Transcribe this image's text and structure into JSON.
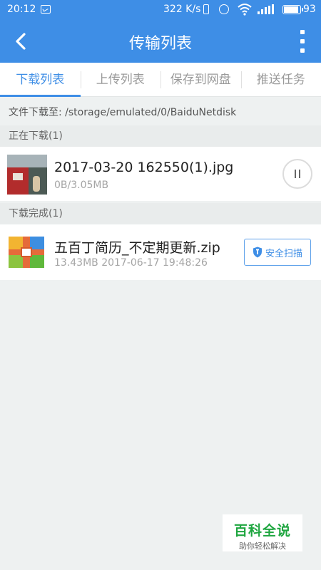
{
  "status_bar": {
    "time": "20:12",
    "network_speed": "322 K/s",
    "battery_level": "93",
    "battery_fraction": 0.93
  },
  "header": {
    "title": "传输列表",
    "back_icon": "back-chevron-icon",
    "menu_icon": "more-vertical-icon"
  },
  "tabs": [
    {
      "label": "下载列表",
      "active": true
    },
    {
      "label": "上传列表",
      "active": false
    },
    {
      "label": "保存到网盘",
      "active": false
    },
    {
      "label": "推送任务",
      "active": false
    }
  ],
  "path_text": "文件下载至: /storage/emulated/0/BaiduNetdisk",
  "downloading": {
    "section_title": "正在下载(1)",
    "items": [
      {
        "name": "2017-03-20 162550(1).jpg",
        "progress": "0B/3.05MB",
        "action_icon": "pause-icon"
      }
    ]
  },
  "completed": {
    "section_title": "下载完成(1)",
    "items": [
      {
        "name": "五百丁简历_不定期更新.zip",
        "meta": "13.43MB 2017-06-17 19:48:26",
        "action_label": "安全扫描",
        "action_icon": "shield-icon"
      }
    ]
  },
  "watermark": {
    "title": "百科全说",
    "subtitle": "助你轻松解决"
  },
  "colors": {
    "accent": "#3e8ee6",
    "background": "#eef1f1"
  }
}
